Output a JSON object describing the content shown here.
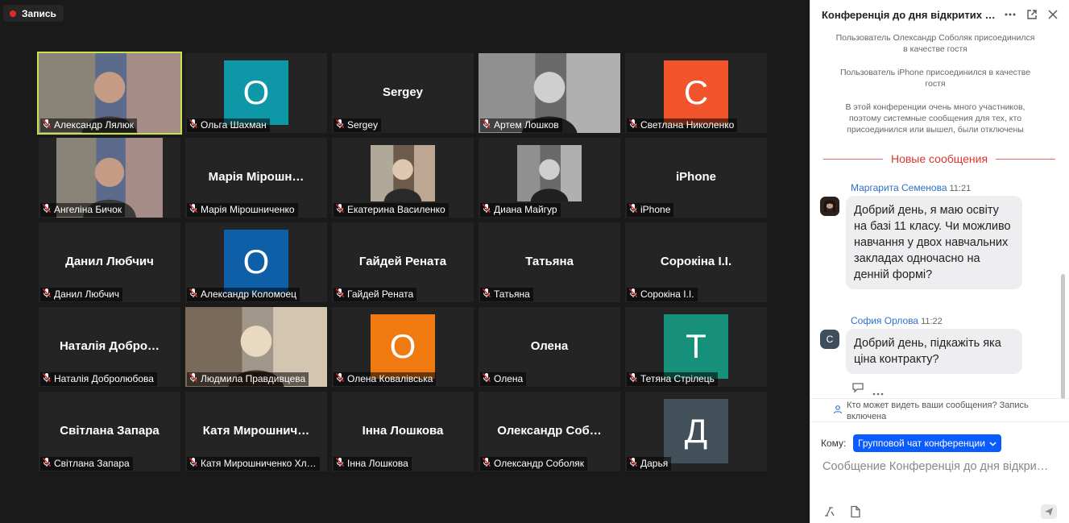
{
  "recording": {
    "label": "Запись"
  },
  "tiles": [
    {
      "name": "Александр Лялюк",
      "display": "",
      "avatar": "",
      "color": "",
      "photo": "full",
      "active": true
    },
    {
      "name": "Ольга Шахман",
      "display": "",
      "avatar": "О",
      "color": "#0e97a6",
      "photo": "",
      "active": false
    },
    {
      "name": "Sergey",
      "display": "Sergey",
      "avatar": "",
      "color": "",
      "photo": "",
      "active": false
    },
    {
      "name": "Артем Лошков",
      "display": "",
      "avatar": "",
      "color": "",
      "photo": "full",
      "active": false
    },
    {
      "name": "Светлана Николенко",
      "display": "",
      "avatar": "С",
      "color": "#f2542b",
      "photo": "",
      "active": false
    },
    {
      "name": "Ангеліна Бичок",
      "display": "",
      "avatar": "",
      "color": "",
      "photo": "wide",
      "active": false
    },
    {
      "name": "Марія Мірошниченко",
      "display": "Марія  Мірошн…",
      "avatar": "",
      "color": "",
      "photo": "",
      "active": false
    },
    {
      "name": "Екатерина Василенко",
      "display": "",
      "avatar": "",
      "color": "",
      "photo": "square",
      "active": false
    },
    {
      "name": "Диана Майгур",
      "display": "",
      "avatar": "",
      "color": "",
      "photo": "square",
      "active": false
    },
    {
      "name": "iPhone",
      "display": "iPhone",
      "avatar": "",
      "color": "",
      "photo": "",
      "active": false
    },
    {
      "name": "Данил Любчич",
      "display": "Данил Любчич",
      "avatar": "",
      "color": "",
      "photo": "",
      "active": false
    },
    {
      "name": "Александр Коломоец",
      "display": "",
      "avatar": "О",
      "color": "#0e5ea8",
      "photo": "",
      "active": false
    },
    {
      "name": "Гайдей Рената",
      "display": "Гайдей Рената",
      "avatar": "",
      "color": "",
      "photo": "",
      "active": false
    },
    {
      "name": "Татьяна",
      "display": "Татьяна",
      "avatar": "",
      "color": "",
      "photo": "",
      "active": false
    },
    {
      "name": "Сорокіна І.І.",
      "display": "Сорокіна І.І.",
      "avatar": "",
      "color": "",
      "photo": "",
      "active": false
    },
    {
      "name": "Наталія Добролюбова",
      "display": "Наталія  Добро…",
      "avatar": "",
      "color": "",
      "photo": "",
      "active": false
    },
    {
      "name": "Людмила Правдивцева",
      "display": "",
      "avatar": "",
      "color": "",
      "photo": "full",
      "active": false
    },
    {
      "name": "Олена Ковалівська",
      "display": "",
      "avatar": "О",
      "color": "#f07a10",
      "photo": "",
      "active": false
    },
    {
      "name": "Олена",
      "display": "Олена",
      "avatar": "",
      "color": "",
      "photo": "",
      "active": false
    },
    {
      "name": "Тетяна Стрілець",
      "display": "",
      "avatar": "Т",
      "color": "#16907a",
      "photo": "",
      "active": false
    },
    {
      "name": "Світлана Запара",
      "display": "Світлана Запара",
      "avatar": "",
      "color": "",
      "photo": "",
      "active": false
    },
    {
      "name": "Катя Мирошниченко Хл…",
      "display": "Катя  Мирошнич…",
      "avatar": "",
      "color": "",
      "photo": "",
      "active": false
    },
    {
      "name": "Інна Лошкова",
      "display": "Інна Лошкова",
      "avatar": "",
      "color": "",
      "photo": "",
      "active": false
    },
    {
      "name": "Олександр Соболяк",
      "display": "Олександр  Соб…",
      "avatar": "",
      "color": "",
      "photo": "",
      "active": false
    },
    {
      "name": "Дарья",
      "display": "",
      "avatar": "Д",
      "color": "#42505a",
      "photo": "",
      "active": false
    }
  ],
  "chat": {
    "title": "Конференція до дня відкритих …",
    "system_messages": [
      "Пользователь Олександр Соболяк присоединился в качестве гостя",
      "Пользователь iPhone присоединился в качестве гостя",
      "В этой конференции очень много участников, поэтому системные сообщения для тех, кто присоединился или вышел, были отключены"
    ],
    "new_messages_label": "Новые сообщения",
    "messages": [
      {
        "sender": "Маргарита Семенова",
        "time": "11:21",
        "avatar": "",
        "text": "Добрий день, я маю освіту на базі 11 класу. Чи можливо навчання у двох навчальних закладах одночасно на денній формі?"
      },
      {
        "sender": "София Орлова",
        "time": "11:22",
        "avatar": "С",
        "text": "Добрий день, підкажіть яка ціна контракту?"
      }
    ],
    "privacy_note": "Кто может видеть ваши сообщения? Запись включена",
    "to_label": "Кому:",
    "to_value": "Групповой чат конференции",
    "compose_placeholder": "Сообщение Конференція до дня відкри…"
  }
}
